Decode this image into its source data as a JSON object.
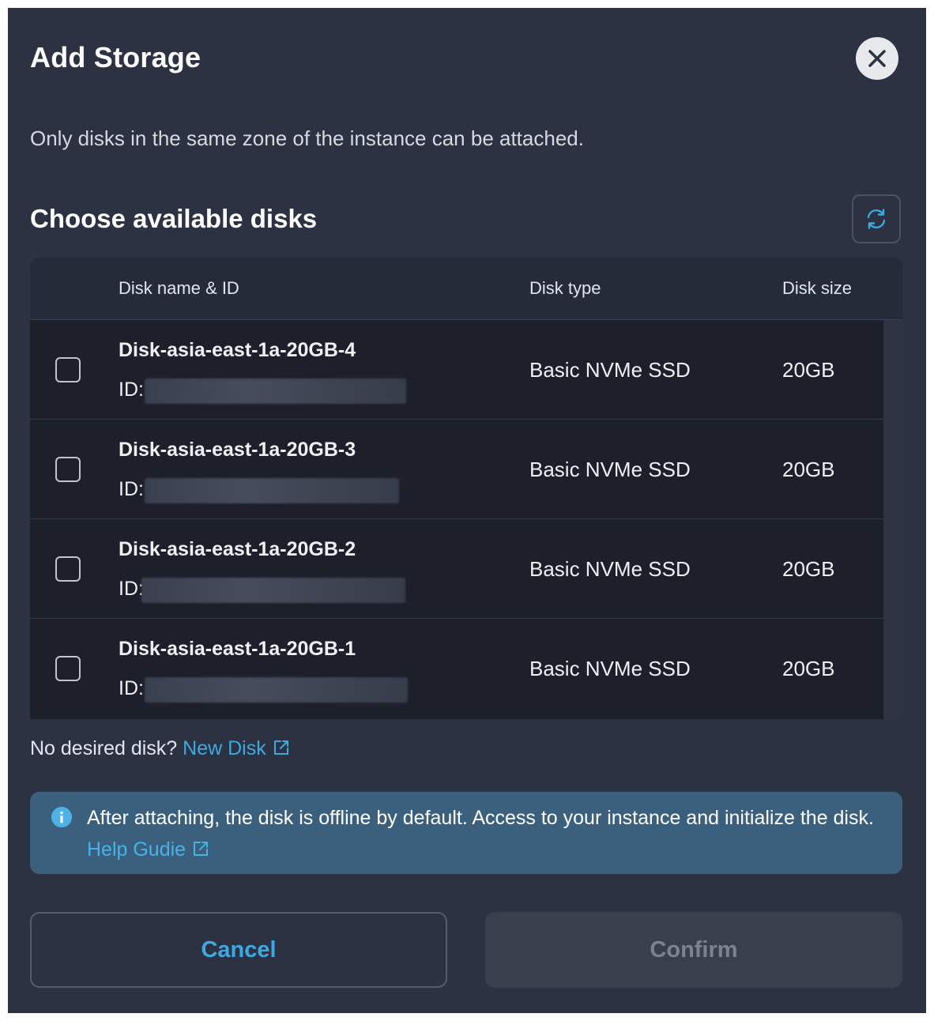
{
  "dialog": {
    "title": "Add Storage",
    "subtitle": "Only disks in the same zone of the instance can be attached.",
    "section_title": "Choose available disks"
  },
  "table": {
    "headers": [
      "Disk name & ID",
      "Disk type",
      "Disk size"
    ],
    "rows": [
      {
        "name": "Disk-asia-east-1a-20GB-4",
        "id_label": "ID:",
        "type": "Basic NVMe SSD",
        "size": "20GB"
      },
      {
        "name": "Disk-asia-east-1a-20GB-3",
        "id_label": "ID:",
        "type": "Basic NVMe SSD",
        "size": "20GB"
      },
      {
        "name": "Disk-asia-east-1a-20GB-2",
        "id_label": "ID:",
        "type": "Basic NVMe SSD",
        "size": "20GB"
      },
      {
        "name": "Disk-asia-east-1a-20GB-1",
        "id_label": "ID:",
        "type": "Basic NVMe SSD",
        "size": "20GB"
      }
    ]
  },
  "no_disk": {
    "text": "No desired disk?",
    "link": "New Disk"
  },
  "info": {
    "text": "After attaching, the disk is offline by default. Access to your instance and initialize the disk.",
    "link": "Help Gudie"
  },
  "buttons": {
    "cancel": "Cancel",
    "confirm": "Confirm"
  },
  "colors": {
    "background": "#2c3242",
    "accent": "#3ea9e0",
    "info_bg": "#3b607e"
  },
  "icons": {
    "close": "close-icon",
    "refresh": "refresh-icon",
    "external": "external-link-icon",
    "info": "info-icon"
  }
}
